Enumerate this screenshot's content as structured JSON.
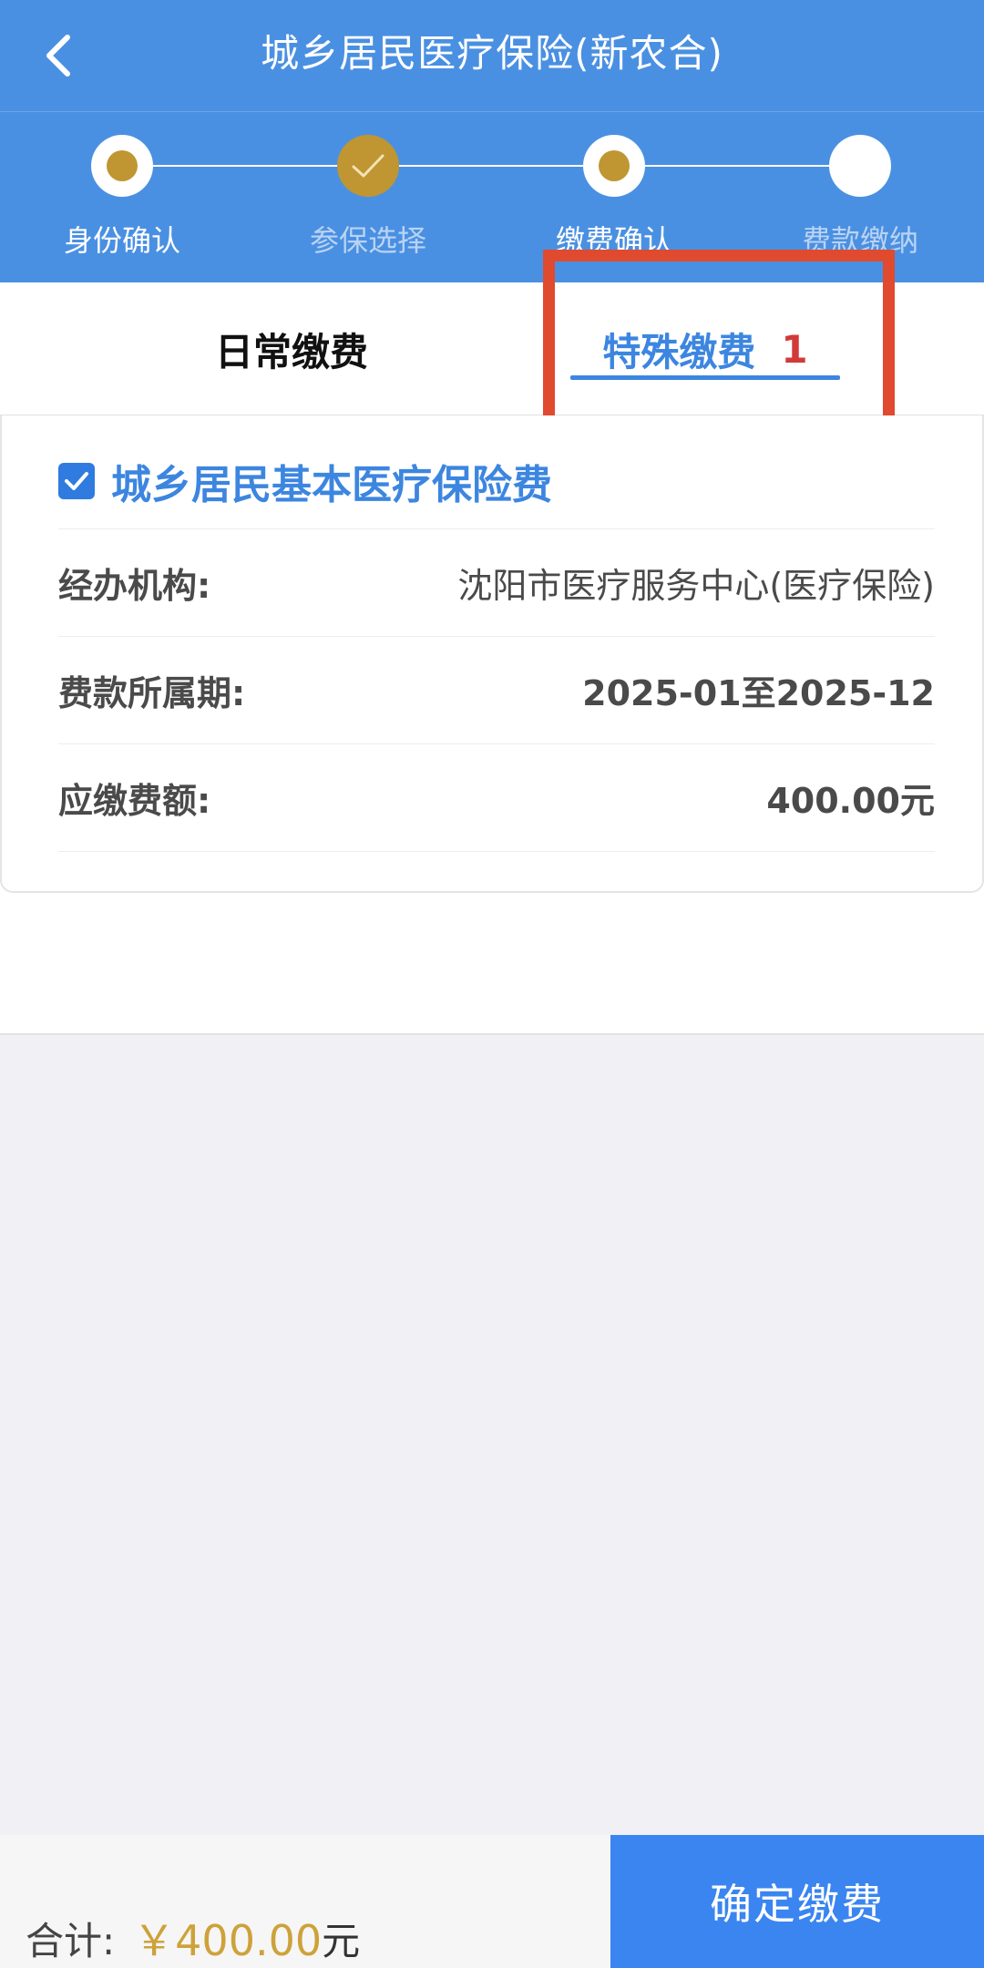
{
  "header": {
    "title": "城乡居民医疗保险(新农合)",
    "back_icon": "chevron-left-icon"
  },
  "stepper": {
    "steps": [
      {
        "label": "身份确认",
        "state": "current",
        "label_color": "#FFFFFF"
      },
      {
        "label": "参保选择",
        "state": "done",
        "label_color": "#B9D3F3"
      },
      {
        "label": "缴费确认",
        "state": "current",
        "label_color": "#FFFFFF"
      },
      {
        "label": "费款缴纳",
        "state": "pending",
        "label_color": "#B9D3F3"
      }
    ]
  },
  "tabs": {
    "normal": {
      "label": "日常缴费"
    },
    "special": {
      "label": "特殊缴费",
      "count": "1"
    }
  },
  "card": {
    "checked": true,
    "title": "城乡居民基本医疗保险费",
    "rows": [
      {
        "label": "经办机构:",
        "value": "沈阳市医疗服务中心(医疗保险)"
      },
      {
        "label": "费款所属期:",
        "value": "2025-01至2025-12"
      },
      {
        "label": "应缴费额:",
        "value": "400.00元"
      }
    ]
  },
  "footer": {
    "total_label": "合计:",
    "total_amount": "￥400.00",
    "total_unit": "元",
    "confirm_label": "确定缴费"
  },
  "colors": {
    "primary": "#4A90E2",
    "gold": "#BF9631",
    "tab_active": "#3C86E0",
    "badge_red": "#D23A3A",
    "highlight": "#E04A2E",
    "button": "#3A85F0"
  }
}
